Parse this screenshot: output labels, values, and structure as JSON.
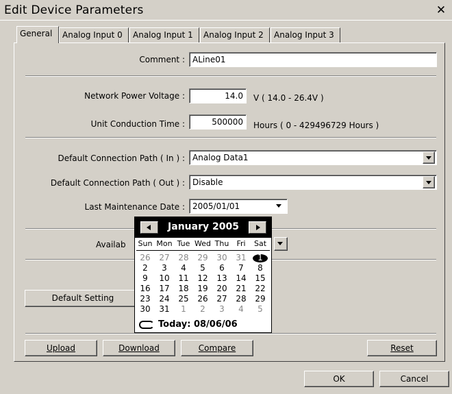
{
  "window": {
    "title": "Edit Device Parameters",
    "close_glyph": "✕"
  },
  "tabs": [
    {
      "label": "General",
      "active": true
    },
    {
      "label": "Analog Input 0",
      "active": false
    },
    {
      "label": "Analog Input 1",
      "active": false
    },
    {
      "label": "Analog Input 2",
      "active": false
    },
    {
      "label": "Analog Input 3",
      "active": false
    }
  ],
  "fields": {
    "comment": {
      "label": "Comment :",
      "value": "ALine01"
    },
    "network_power_voltage": {
      "label": "Network Power Voltage :",
      "value": "14.0",
      "unit": "V ( 14.0 - 26.4V )"
    },
    "unit_conduction_time": {
      "label": "Unit Conduction Time :",
      "value": "500000",
      "unit": "Hours ( 0 - 429496729 Hours )"
    },
    "default_path_in": {
      "label": "Default Connection Path ( In ) :",
      "value": "Analog Data1"
    },
    "default_path_out": {
      "label": "Default Connection Path ( Out ) :",
      "value": "Disable"
    },
    "last_maintenance_date": {
      "label": "Last Maintenance Date :",
      "value": "2005/01/01"
    },
    "available_partial": {
      "label": "Availab"
    }
  },
  "buttons": {
    "default_setting": "Default Setting",
    "upload": "Upload",
    "download": "Download",
    "compare": "Compare",
    "reset": "Reset",
    "ok": "OK",
    "cancel": "Cancel"
  },
  "calendar": {
    "month": "January 2005",
    "days_of_week": [
      "Sun",
      "Mon",
      "Tue",
      "Wed",
      "Thu",
      "Fri",
      "Sat"
    ],
    "weeks": [
      [
        "26",
        "27",
        "28",
        "29",
        "30",
        "31",
        "1"
      ],
      [
        "2",
        "3",
        "4",
        "5",
        "6",
        "7",
        "8"
      ],
      [
        "9",
        "10",
        "11",
        "12",
        "13",
        "14",
        "15"
      ],
      [
        "16",
        "17",
        "18",
        "19",
        "20",
        "21",
        "22"
      ],
      [
        "23",
        "24",
        "25",
        "26",
        "27",
        "28",
        "29"
      ],
      [
        "30",
        "31",
        "1",
        "2",
        "3",
        "4",
        "5"
      ]
    ],
    "today_label": "Today: 08/06/06"
  }
}
